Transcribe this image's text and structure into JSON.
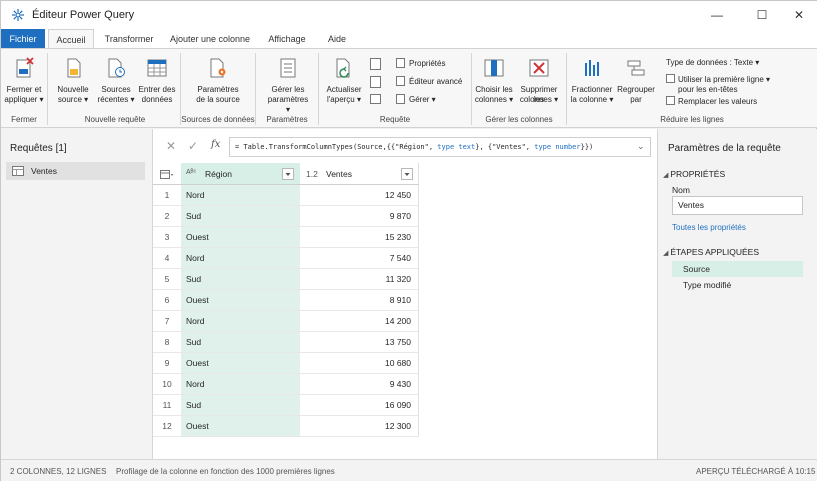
{
  "window": {
    "title": "Éditeur Power Query",
    "minimize_glyph": "—",
    "maximize_glyph": "☐",
    "close_glyph": "✕"
  },
  "tabs": [
    "Fichier",
    "Accueil",
    "Transformer",
    "Ajouter une colonne",
    "Affichage",
    "Aide"
  ],
  "ribbon": {
    "fermer": {
      "btn": [
        "Fermer et",
        "appliquer ▾"
      ],
      "group": "Fermer"
    },
    "nouvelle_requete": {
      "nouvelle_source": [
        "Nouvelle",
        "source ▾"
      ],
      "sources_recentes": [
        "Sources",
        "récentes ▾"
      ],
      "entrer_donnees": [
        "Entrer des",
        "données"
      ],
      "group": "Nouvelle requête"
    },
    "sources": {
      "btn": [
        "Paramètres",
        "de la source"
      ],
      "group": "Sources de données"
    },
    "parametres": {
      "btn": [
        "Gérer les",
        "paramètres ▾"
      ],
      "group": "Paramètres"
    },
    "requete": {
      "actualiser": [
        "Actualiser",
        "l'aperçu ▾"
      ],
      "proprietes": "Propriétés",
      "editeur": "Éditeur avancé",
      "gerer": "Gérer ▾",
      "group": "Requête"
    },
    "colonnes": {
      "choisir": [
        "Choisir les",
        "colonnes ▾"
      ],
      "supprimer": [
        "Supprimer les",
        "colonnes ▾"
      ],
      "group": "Gérer les colonnes"
    },
    "reduire": {
      "fractionner": [
        "Fractionner",
        "la colonne ▾"
      ],
      "regrouper": [
        "Regrouper",
        "par"
      ],
      "type_donnees": "Type de données : Texte ▾",
      "premiere_ligne": [
        "Utiliser la première ligne ▾",
        "pour les en-têtes"
      ],
      "remplacer": "Remplacer les valeurs",
      "group": "Réduire les lignes"
    }
  },
  "queries_pane": {
    "title": "Requêtes [1]",
    "items": [
      "Ventes"
    ]
  },
  "formula": {
    "prefix": "= Table.TransformColumnTypes(Source,{{\"Région\", ",
    "kw1": "type text",
    "mid": "}, {\"Ventes\", ",
    "kw2": "type number",
    "suffix": "}})"
  },
  "grid": {
    "columns": [
      {
        "type_icon": "Aᴮᶜ",
        "name": "Région"
      },
      {
        "type_icon": "1.2",
        "name": "Ventes"
      }
    ],
    "rows": [
      [
        "1",
        "Nord",
        "12 450"
      ],
      [
        "2",
        "Sud",
        "9 870"
      ],
      [
        "3",
        "Ouest",
        "15 230"
      ],
      [
        "4",
        "Nord",
        "7 540"
      ],
      [
        "5",
        "Sud",
        "11 320"
      ],
      [
        "6",
        "Ouest",
        "8 910"
      ],
      [
        "7",
        "Nord",
        "14 200"
      ],
      [
        "8",
        "Sud",
        "13 750"
      ],
      [
        "9",
        "Ouest",
        "10 680"
      ],
      [
        "10",
        "Nord",
        "9 430"
      ],
      [
        "11",
        "Sud",
        "16 090"
      ],
      [
        "12",
        "Ouest",
        "12 300"
      ]
    ]
  },
  "settings_pane": {
    "title": "Paramètres de la requête",
    "properties_header": "PROPRIÉTÉS",
    "name_label": "Nom",
    "name_value": "Ventes",
    "all_properties_link": "Toutes les propriétés",
    "steps_header": "ÉTAPES APPLIQUÉES",
    "steps": [
      "Source",
      "Type modifié"
    ],
    "selected_step": 0
  },
  "status": {
    "left": "2 COLONNES, 12 LIGNES",
    "middle": "Profilage de la colonne en fonction des 1000 premières lignes",
    "right": "APERÇU TÉLÉCHARGÉ À 10:15"
  },
  "colors": {
    "accent": "#1e6fbf",
    "selected_column": "#dff1ea",
    "file_tab": "#1e6fbf"
  }
}
